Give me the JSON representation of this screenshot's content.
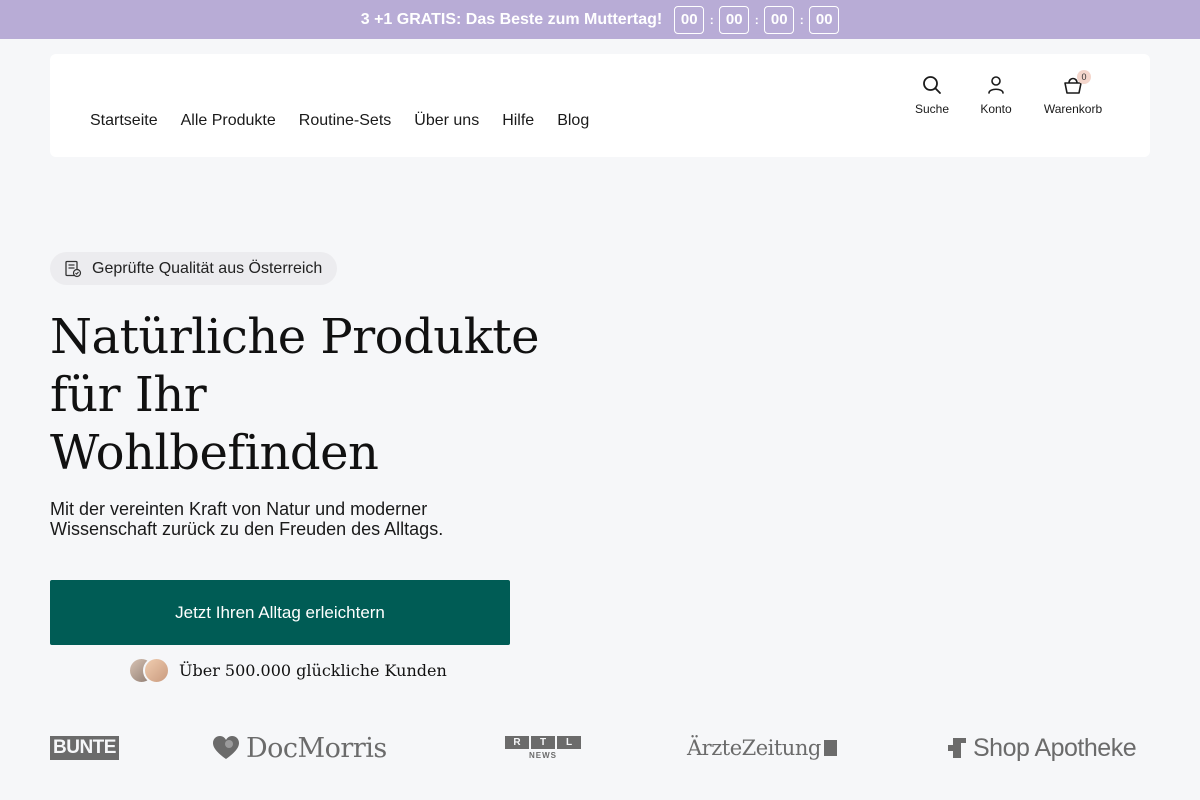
{
  "promo": {
    "text": "3 +1 GRATIS: Das Beste zum Muttertag!",
    "countdown": [
      "00",
      "00",
      "00",
      "00"
    ],
    "separator": ":"
  },
  "nav": {
    "items": [
      "Startseite",
      "Alle Produkte",
      "Routine-Sets",
      "Über uns",
      "Hilfe",
      "Blog"
    ]
  },
  "tools": {
    "search_label": "Suche",
    "account_label": "Konto",
    "cart_label": "Warenkorb",
    "cart_count": "0"
  },
  "hero": {
    "badge_text": "Geprüfte Qualität aus Österreich",
    "title_lines": [
      "Natürliche Produkte",
      "für Ihr",
      "Wohlbefinden"
    ],
    "subtitle": "Mit der vereinten Kraft von Natur und moderner Wissenschaft zurück zu den Freuden des Alltags.",
    "cta_label": "Jetzt Ihren Alltag erleichtern",
    "social_proof": "Über 500.000 glückliche Kunden"
  },
  "press_logos": {
    "bunte": "BUNTE",
    "docmorris": "DocMorris",
    "rtl": [
      "R",
      "T",
      "L"
    ],
    "rtl_sub": "NEWS",
    "aerzte": "ÄrzteZeitung",
    "shop_apotheke": "Shop Apotheke"
  },
  "colors": {
    "promo_bg": "#b8acd6",
    "cta_bg": "#005c55",
    "page_bg": "#f6f7f9",
    "logo_gray": "#6b6b6b"
  }
}
